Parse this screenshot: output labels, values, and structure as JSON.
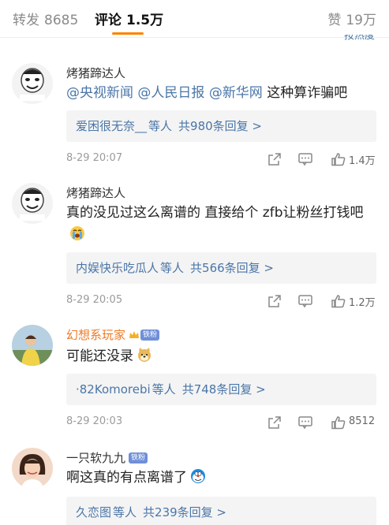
{
  "tabs": {
    "repost": {
      "label": "转发",
      "count": "8685"
    },
    "comment": {
      "label": "评论",
      "count": "1.5万"
    },
    "like": {
      "label": "赞",
      "count": "19万"
    }
  },
  "sort_label": "按热度",
  "colors": {
    "accent": "#ff8200",
    "link": "#4a76a8",
    "vip_name": "#ee7a28"
  },
  "comments": [
    {
      "username": "烤猪蹄达人",
      "mentions": [
        "@央视新闻",
        "@人民日报",
        "@新华网"
      ],
      "text": "这种算诈骗吧",
      "reply": {
        "user": "爱困很无奈__",
        "static": "等人",
        "count": "共980条回复 >"
      },
      "time": "8-29 20:07",
      "likes": "1.4万"
    },
    {
      "username": "烤猪蹄达人",
      "text": "真的没见过这么离谱的 直接给个 zfb让粉丝打钱吧",
      "emoji": "crying-emoji",
      "reply": {
        "user": "内娱快乐吃瓜人",
        "static": "等人",
        "count": "共566条回复 >"
      },
      "time": "8-29 20:05",
      "likes": "1.2万"
    },
    {
      "username": "幻想系玩家",
      "badge": "铁粉",
      "text": "可能还没录",
      "emoji": "doge-emoji",
      "reply": {
        "user": "·82Komorebi",
        "static": "等人",
        "count": "共748条回复 >"
      },
      "time": "8-29 20:03",
      "likes": "8512"
    },
    {
      "username": "一只软九九",
      "badge": "铁粉",
      "text": "啊这真的有点离谱了",
      "emoji": "doraemon-emoji",
      "reply": {
        "user": "久恋图",
        "static": "等人",
        "count": "共239条回复 >"
      }
    }
  ]
}
